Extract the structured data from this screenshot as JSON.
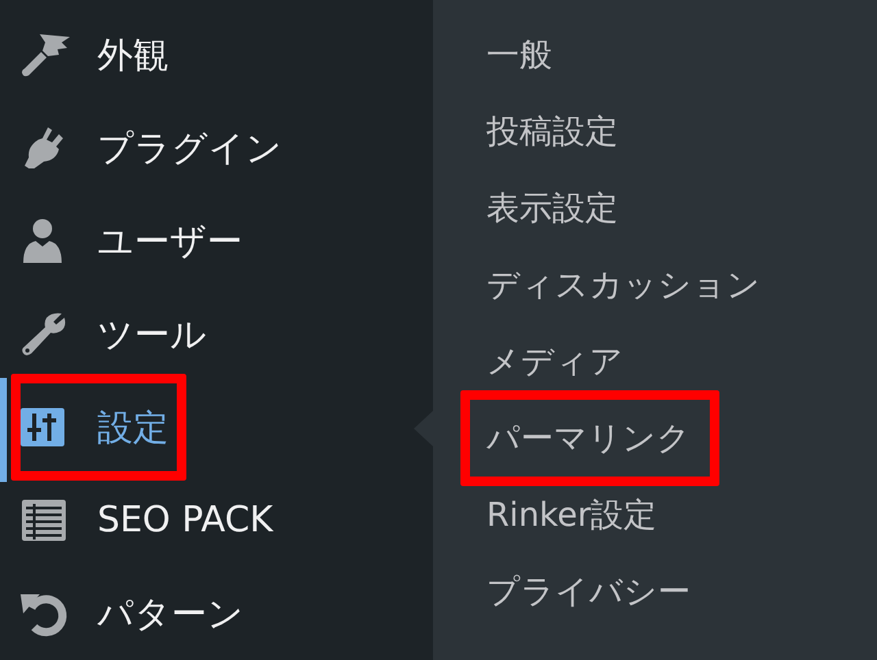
{
  "menu": {
    "items": [
      {
        "label": "外観",
        "kind": "brush",
        "selected": false,
        "highlighted": false
      },
      {
        "label": "プラグイン",
        "kind": "plug",
        "selected": false,
        "highlighted": false
      },
      {
        "label": "ユーザー",
        "kind": "user",
        "selected": false,
        "highlighted": false
      },
      {
        "label": "ツール",
        "kind": "wrench",
        "selected": false,
        "highlighted": false
      },
      {
        "label": "設定",
        "kind": "sliders",
        "selected": true,
        "highlighted": true
      },
      {
        "label": "SEO PACK",
        "kind": "list",
        "selected": false,
        "highlighted": false
      },
      {
        "label": "パターン",
        "kind": "undo",
        "selected": false,
        "highlighted": false
      }
    ]
  },
  "submenu": {
    "items": [
      {
        "label": "一般",
        "highlighted": false
      },
      {
        "label": "投稿設定",
        "highlighted": false
      },
      {
        "label": "表示設定",
        "highlighted": false
      },
      {
        "label": "ディスカッション",
        "highlighted": false
      },
      {
        "label": "メディア",
        "highlighted": false
      },
      {
        "label": "パーマリンク",
        "highlighted": true
      },
      {
        "label": "Rinker設定",
        "highlighted": false
      },
      {
        "label": "プライバシー",
        "highlighted": false
      }
    ]
  }
}
